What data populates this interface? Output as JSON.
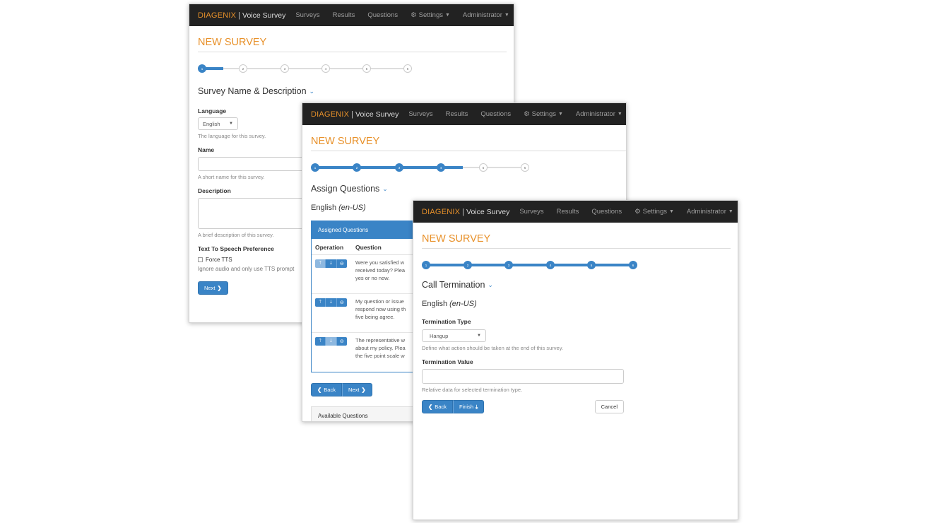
{
  "navbar": {
    "brand": "DIAGENIX",
    "separator": "|",
    "app_name": "Voice Survey",
    "items": [
      "Surveys",
      "Results",
      "Questions"
    ],
    "settings": "Settings",
    "admin": "Administrator"
  },
  "page_title": "NEW SURVEY",
  "colors": {
    "accent": "#3a84c6",
    "brand": "#e8912a",
    "navbar": "#222222"
  },
  "step_labels": [
    "1",
    "2",
    "3",
    "4",
    "5",
    "6"
  ],
  "windows": [
    {
      "id": "step1",
      "current_step": 1,
      "section_title": "Survey Name & Description",
      "language_label": "Language",
      "language_value": "English",
      "language_help": "The language for this survey.",
      "name_label": "Name",
      "name_value": "",
      "name_help": "A short name for this survey.",
      "description_label": "Description",
      "description_value": "",
      "description_help": "A brief description of this survey.",
      "tts_label": "Text To Speech Preference",
      "tts_checkbox": "Force TTS",
      "tts_help": "Ignore audio and only use TTS prompt",
      "next_button": "Next"
    },
    {
      "id": "step4",
      "current_step": 4,
      "section_title": "Assign Questions",
      "language_name": "English",
      "language_code": "(en-US)",
      "panel_heading": "Assigned Questions",
      "col_operation": "Operation",
      "col_question": "Question",
      "questions": [
        {
          "lines": [
            "Were you satisfied w",
            "received today? Plea",
            "yes or no now."
          ]
        },
        {
          "lines": [
            "My question or issue",
            "respond now using th",
            "five being agree."
          ]
        },
        {
          "lines": [
            "The representative w",
            "about my policy. Plea",
            "the five point scale w"
          ]
        }
      ],
      "back_button": "Back",
      "next_button": "Next",
      "available_heading": "Available Questions"
    },
    {
      "id": "step6",
      "current_step": 6,
      "section_title": "Call Termination",
      "language_name": "English",
      "language_code": "(en-US)",
      "type_label": "Termination Type",
      "type_value": "Hangup",
      "type_help": "Define what action should be taken at the end of this survey.",
      "value_label": "Termination Value",
      "value_value": "",
      "value_help": "Relative data for selected termination type.",
      "back_button": "Back",
      "finish_button": "Finish",
      "cancel_button": "Cancel"
    }
  ]
}
